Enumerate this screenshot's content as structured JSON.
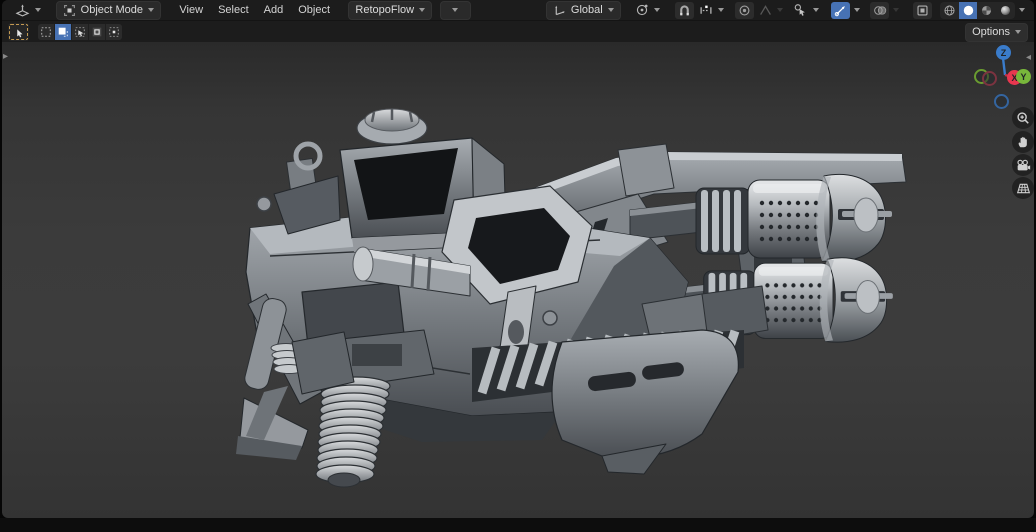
{
  "header": {
    "mode": {
      "label": "Object Mode"
    },
    "menus": [
      {
        "label": "View"
      },
      {
        "label": "Select"
      },
      {
        "label": "Add"
      },
      {
        "label": "Object"
      }
    ],
    "addon_menu": {
      "label": "RetopoFlow"
    },
    "orientation": {
      "label": "Global"
    },
    "icons_left": [
      "editor-type-3d-viewport",
      "object-mode"
    ],
    "icons_center": [
      "transform-orientation",
      "pivot-point",
      "snap-magnet",
      "snap-increment",
      "proportional-editing",
      "falloff-smooth"
    ],
    "icons_right": [
      "object-type-visibility",
      "show-gizmos",
      "show-overlays",
      "toggle-xray",
      "shading-wireframe",
      "shading-solid",
      "shading-material-preview",
      "shading-rendered"
    ],
    "state": {
      "active_shading": "solid",
      "show_gizmos": true,
      "show_overlays": false
    }
  },
  "tool_settings": {
    "active_tool": "select-box",
    "select_modes": [
      "set",
      "extend",
      "subtract",
      "difference",
      "intersect"
    ],
    "active_select_mode": "extend",
    "options": {
      "label": "Options"
    }
  },
  "viewport": {
    "axis_gizmo": {
      "x_label": "X",
      "y_label": "Y",
      "z_label": "Z"
    },
    "nav_buttons": [
      "zoom-view",
      "pan-view",
      "camera-view",
      "toggle-orthographic"
    ],
    "scene_object": "sci-fi twin-barrel rifle model"
  },
  "colors": {
    "accent_blue": "#4772b4",
    "axis_x": "#e8374f",
    "axis_y": "#78b73b",
    "axis_z": "#3a7ccb",
    "header_bg": "#1c1c1c",
    "viewport_bg": "#3a3a3a",
    "tool_active_outline": "#c49a52"
  }
}
